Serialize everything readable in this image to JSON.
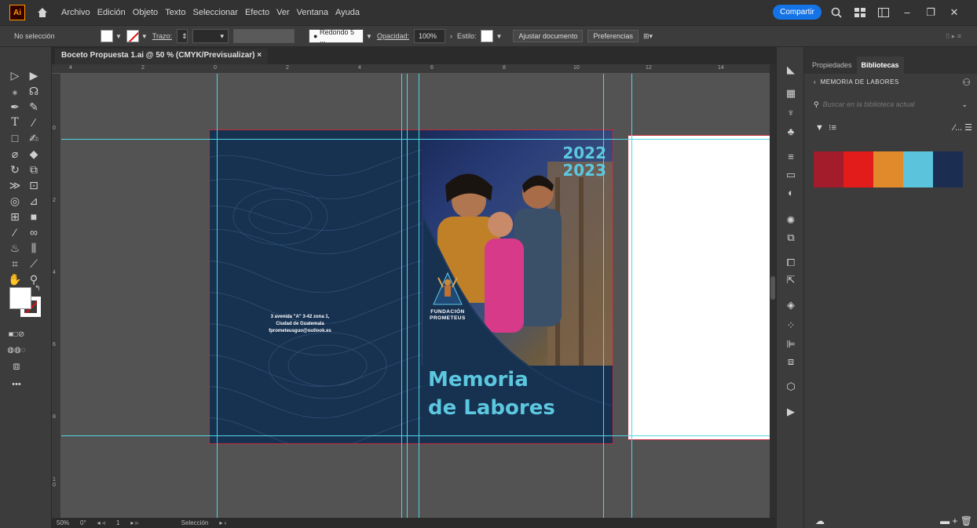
{
  "app": {
    "logo": "Ai"
  },
  "menu": [
    "Archivo",
    "Edición",
    "Objeto",
    "Texto",
    "Seleccionar",
    "Efecto",
    "Ver",
    "Ventana",
    "Ayuda"
  ],
  "menubar_right": {
    "share": "Compartir"
  },
  "control": {
    "selection": "No selección",
    "stroke_label": "Trazo:",
    "brush": "Redondo 5 ...",
    "opacity_label": "Opacidad:",
    "opacity_value": "100%",
    "style_label": "Estilo:",
    "fit_button": "Ajustar documento",
    "prefs_button": "Preferencias"
  },
  "document": {
    "tab_title": "Boceto Propuesta 1.ai @ 50 % (CMYK/Previsualizar)",
    "close": "×"
  },
  "ruler_h": [
    "4",
    "2",
    "0",
    "2",
    "4",
    "6",
    "8",
    "10",
    "12",
    "14"
  ],
  "ruler_v": [
    "0",
    "2",
    "4",
    "6",
    "8",
    "1 0"
  ],
  "artwork": {
    "year1": "2022",
    "year2": "2023",
    "title1": "Memoria",
    "title2": "de Labores",
    "address1": "3 avenida \"A\" 3-42 zona 1,",
    "address2": "Ciudad de Guatemala",
    "address3": "fprometeusguo@outlook.es",
    "foundation1": "FUNDACIÓN",
    "foundation2": "PROMETEUS"
  },
  "status": {
    "zoom": "50%",
    "rotation": "0°",
    "artboard": "1",
    "tool": "Selección"
  },
  "panel": {
    "tabs": [
      "Propiedades",
      "Bibliotecas"
    ],
    "library_name": "MEMORIA DE LABORES",
    "search_placeholder": "Buscar en la biblioteca actual",
    "colors": [
      "#a31c2c",
      "#e21b1b",
      "#e08a2c",
      "#5cc3dc",
      "#1b2e52"
    ]
  }
}
